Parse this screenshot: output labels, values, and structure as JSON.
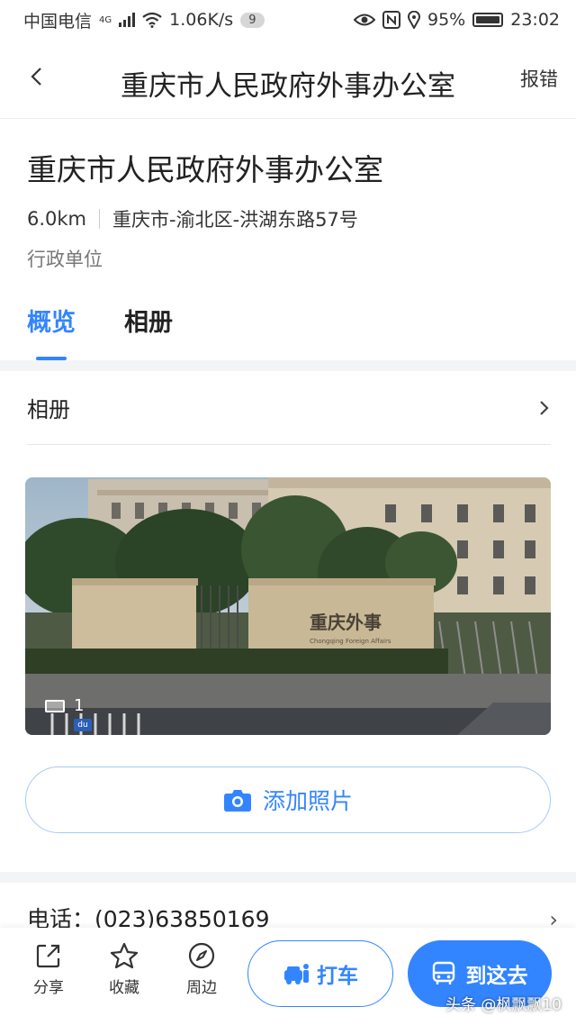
{
  "status_bar": {
    "carrier": "中国电信",
    "network": "4G",
    "speed": "1.06K/s",
    "notification_count": "9",
    "battery": "95%",
    "time": "23:02"
  },
  "header": {
    "title": "重庆市人民政府外事办公室",
    "report_label": "报错"
  },
  "place": {
    "name": "重庆市人民政府外事办公室",
    "distance": "6.0km",
    "address": "重庆市-渝北区-洪湖东路57号",
    "category": "行政单位"
  },
  "tabs": [
    {
      "label": "概览",
      "active": true
    },
    {
      "label": "相册",
      "active": false
    }
  ],
  "album": {
    "title": "相册",
    "photo_count": "1",
    "photo_sign_text": "重庆外事",
    "photo_sign_subtext": "Chongqing Foreign Affairs",
    "badge": "du",
    "add_photo_label": "添加照片"
  },
  "phone": {
    "label": "电话：",
    "number": "(023)63850169"
  },
  "bottom_bar": {
    "actions": [
      {
        "label": "分享",
        "icon": "share-icon"
      },
      {
        "label": "收藏",
        "icon": "star-icon"
      },
      {
        "label": "周边",
        "icon": "compass-icon"
      }
    ],
    "taxi_label": "打车",
    "go_label": "到这去"
  },
  "watermark": "头条 @枫飘飘10",
  "colors": {
    "accent": "#3385ff",
    "text": "#222222",
    "muted": "#777777",
    "divider": "#f3f4f6"
  }
}
